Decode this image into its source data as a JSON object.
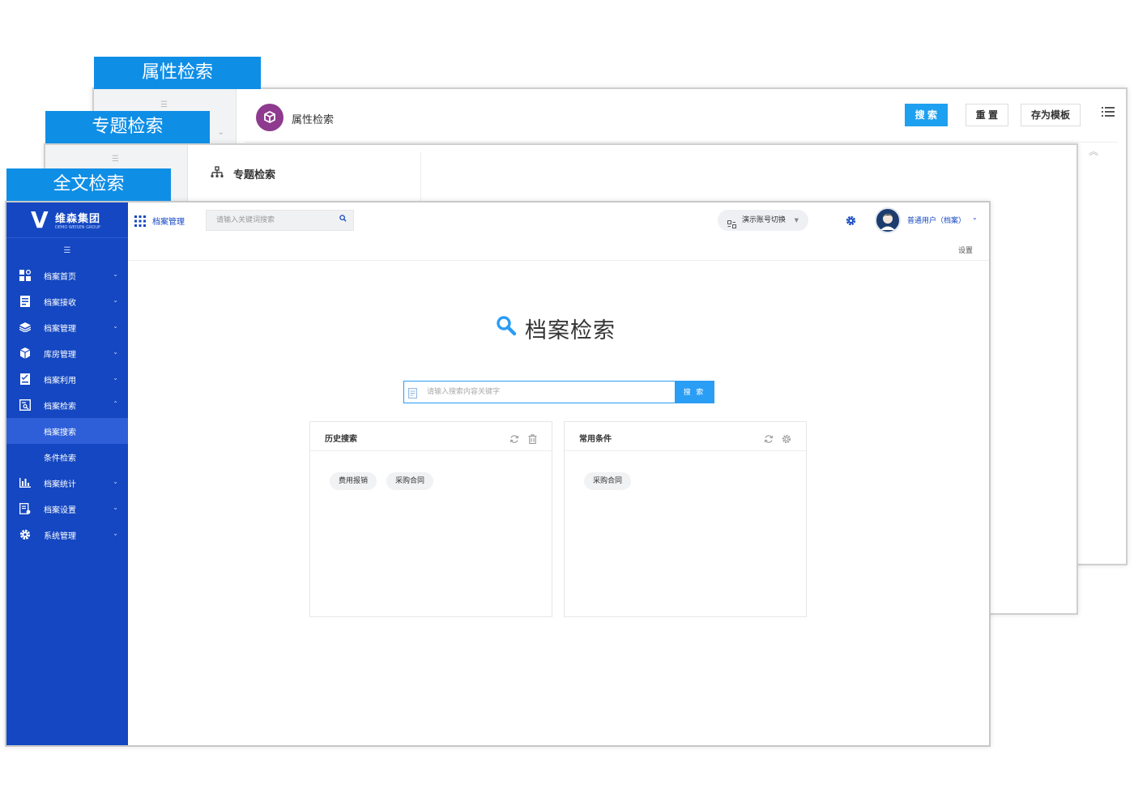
{
  "tabs": {
    "attr": "属性检索",
    "topic": "专题检索",
    "fulltext": "全文检索"
  },
  "attr_window": {
    "header_title": "属性检索",
    "buttons": {
      "search": "搜 索",
      "reset": "重 置",
      "save_template": "存为模板"
    }
  },
  "topic_window": {
    "panel_title": "专题检索"
  },
  "main_window": {
    "logo": {
      "mark": "V",
      "name": "维森集团",
      "sub": "DEMO WEISEN GROUP"
    },
    "topbar": {
      "app_title": "档案管理",
      "search_placeholder": "请输入关键词搜索",
      "account_switch": "演示账号切换",
      "user_name": "普通用户（档案）"
    },
    "settings_link": "设置",
    "sidebar": {
      "items": [
        {
          "label": "档案首页",
          "icon": "dashboard-icon"
        },
        {
          "label": "档案接收",
          "icon": "receive-icon"
        },
        {
          "label": "档案管理",
          "icon": "layers-icon"
        },
        {
          "label": "库房管理",
          "icon": "box-icon"
        },
        {
          "label": "档案利用",
          "icon": "checklist-icon"
        },
        {
          "label": "档案检索",
          "icon": "search-doc-icon"
        },
        {
          "label": "档案统计",
          "icon": "bar-chart-icon"
        },
        {
          "label": "档案设置",
          "icon": "doc-settings-icon"
        },
        {
          "label": "系统管理",
          "icon": "gear-icon"
        }
      ],
      "sub_items": [
        {
          "label": "档案搜索",
          "active": true
        },
        {
          "label": "条件检索",
          "active": false
        }
      ]
    },
    "page_title": "档案检索",
    "main_search": {
      "placeholder": "请输入搜索内容关键字",
      "button": "搜 索"
    },
    "history_card": {
      "title": "历史搜索",
      "tags": [
        "费用报销",
        "采购合同"
      ]
    },
    "common_card": {
      "title": "常用条件",
      "tags": [
        "采购合同"
      ]
    }
  },
  "colors": {
    "tab_blue": "#0f8ee6",
    "sidebar_blue": "#1447c1",
    "accent_blue": "#2a9df4",
    "cube_purple": "#8e3a8f"
  }
}
